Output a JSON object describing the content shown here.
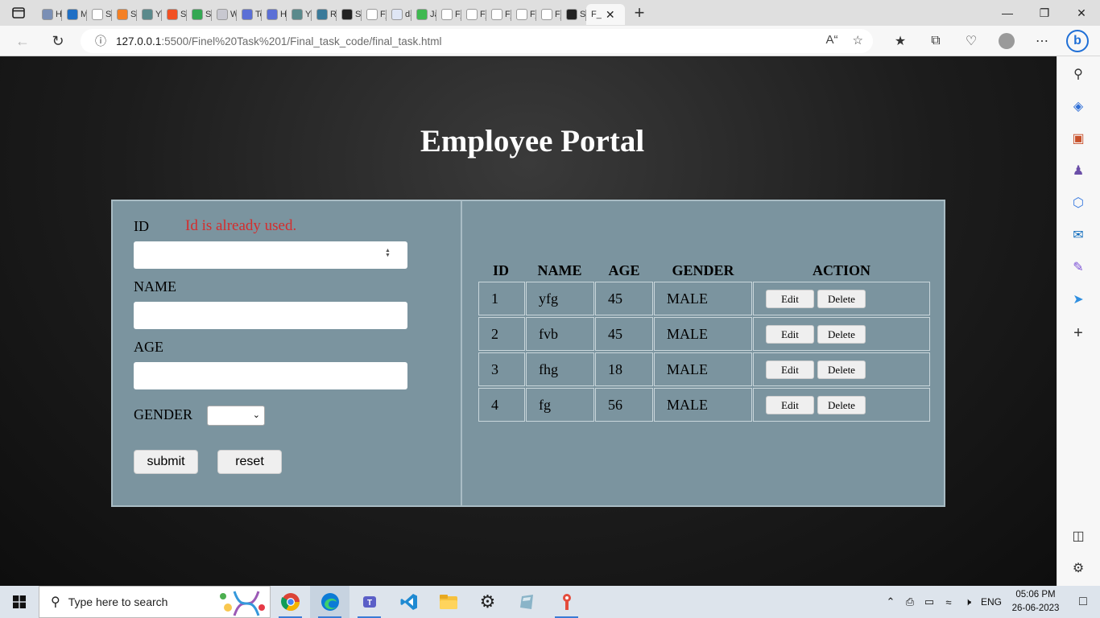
{
  "browser": {
    "tabs": [
      {
        "label": "Hc",
        "color": "#7a8fb5"
      },
      {
        "label": "M",
        "color": "#1f6fc5"
      },
      {
        "label": "Se",
        "color": "#ffffff"
      },
      {
        "label": "Se",
        "color": "#f48024"
      },
      {
        "label": "Yc",
        "color": "#5a8a8c"
      },
      {
        "label": "Sit",
        "color": "#f25022"
      },
      {
        "label": "SA",
        "color": "#34a853"
      },
      {
        "label": "W",
        "color": "#c8c8d0"
      },
      {
        "label": "Tc",
        "color": "#5b6fd6"
      },
      {
        "label": "Hc",
        "color": "#5b6fd6"
      },
      {
        "label": "Yc",
        "color": "#5a8a8c"
      },
      {
        "label": "RE",
        "color": "#3a7a9a"
      },
      {
        "label": "Sa",
        "color": "#222222"
      },
      {
        "label": "F_",
        "color": "#ffffff"
      },
      {
        "label": "da",
        "color": "#dfe6f5"
      },
      {
        "label": "Ja",
        "color": "#3fb950"
      },
      {
        "label": "F_",
        "color": "#ffffff"
      },
      {
        "label": "F_",
        "color": "#ffffff"
      },
      {
        "label": "F_",
        "color": "#ffffff"
      },
      {
        "label": "F_",
        "color": "#ffffff"
      },
      {
        "label": "F_",
        "color": "#ffffff"
      },
      {
        "label": "Sa",
        "color": "#222222"
      }
    ],
    "active_tab": {
      "label": "F_"
    },
    "url_host": "127.0.0.1",
    "url_path": ":5500/Finel%20Task%201/Final_task_code/final_task.html"
  },
  "page": {
    "title": "Employee Portal",
    "form": {
      "id_label": "ID",
      "id_error": "Id is already used.",
      "id_value": "",
      "name_label": "NAME",
      "name_value": "",
      "age_label": "AGE",
      "age_value": "",
      "gender_label": "GENDER",
      "gender_value": "",
      "submit_label": "submit",
      "reset_label": "reset"
    },
    "table": {
      "headers": [
        "ID",
        "NAME",
        "AGE",
        "GENDER",
        "ACTION"
      ],
      "rows": [
        {
          "id": "1",
          "name": "yfg",
          "age": "45",
          "gender": "MALE"
        },
        {
          "id": "2",
          "name": "fvb",
          "age": "45",
          "gender": "MALE"
        },
        {
          "id": "3",
          "name": "fhg",
          "age": "18",
          "gender": "MALE"
        },
        {
          "id": "4",
          "name": "fg",
          "age": "56",
          "gender": "MALE"
        }
      ],
      "edit_label": "Edit",
      "delete_label": "Delete"
    }
  },
  "taskbar": {
    "search_placeholder": "Type here to search",
    "language": "ENG",
    "time": "05:06 PM",
    "date": "26-06-2023"
  }
}
